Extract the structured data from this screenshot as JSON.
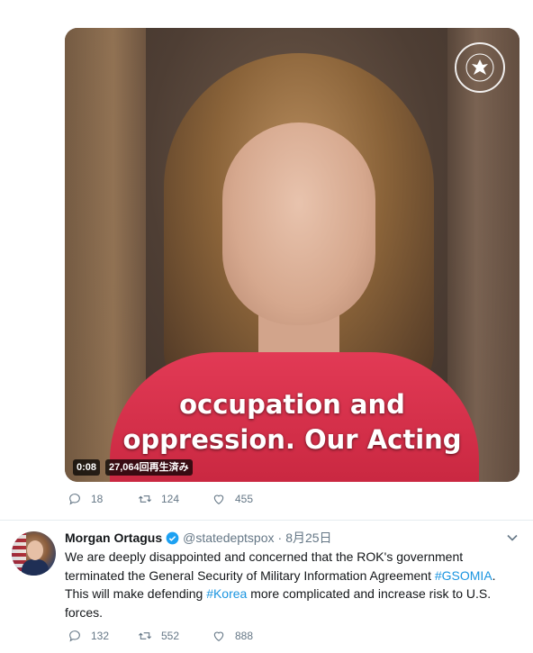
{
  "tweet1": {
    "video": {
      "caption_line1": "occupation and",
      "caption_line2": "oppression. Our Acting",
      "time": "0:08",
      "views": "27,064回再生済み"
    },
    "actions": {
      "replies": "18",
      "retweets": "124",
      "likes": "455"
    }
  },
  "tweet2": {
    "author_name": "Morgan Ortagus",
    "handle": "@statedeptspox",
    "separator": "·",
    "date": "8月25日",
    "text_part1": "We are deeply disappointed and concerned that the ROK's government terminated the General Security of Military Information Agreement ",
    "hashtag1": "#GSOMIA",
    "text_part2": ". This will make defending ",
    "hashtag2": "#Korea",
    "text_part3": " more complicated and increase risk to U.S. forces.",
    "actions": {
      "replies": "132",
      "retweets": "552",
      "likes": "888"
    }
  },
  "colors": {
    "link": "#1b95e0",
    "muted": "#657786",
    "verified": "#1da1f2"
  },
  "icons": [
    "reply-icon",
    "retweet-icon",
    "like-icon",
    "verified-icon",
    "chevron-down-icon",
    "seal-icon"
  ]
}
